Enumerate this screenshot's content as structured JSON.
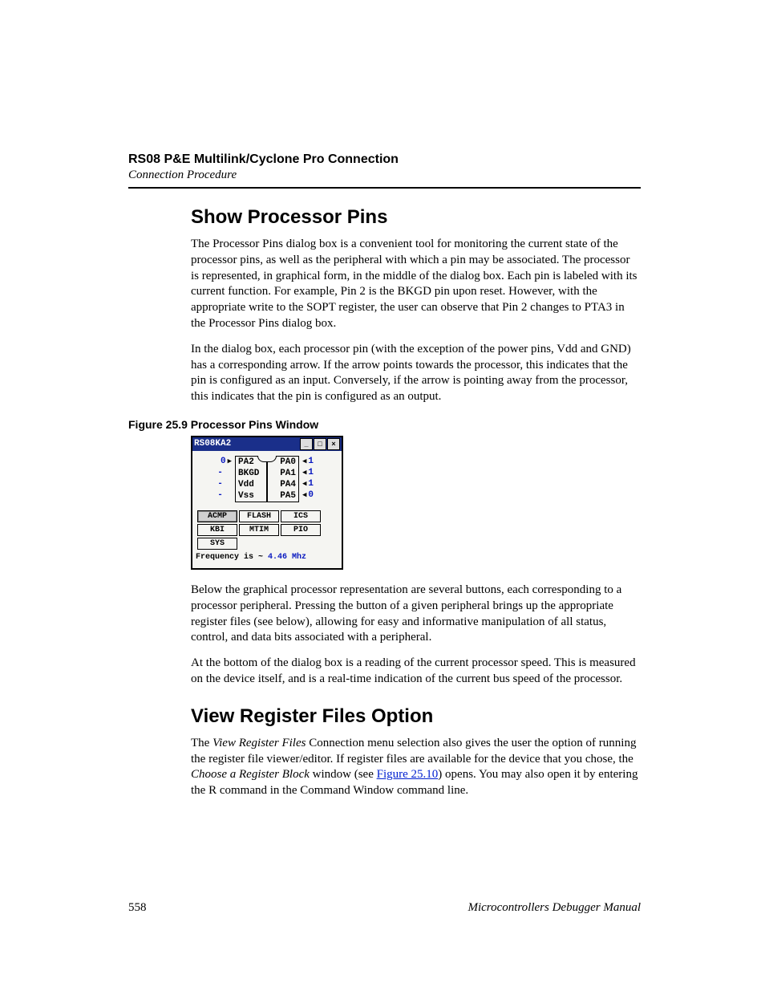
{
  "header": {
    "title": "RS08 P&E Multilink/Cyclone Pro Connection",
    "subtitle": "Connection Procedure"
  },
  "sections": {
    "s1": {
      "heading": "Show Processor Pins",
      "p1": "The Processor Pins dialog box is a convenient tool for monitoring the current state of the processor pins, as well as the peripheral with which a pin may be associated. The processor is represented, in graphical form, in the middle of the dialog box. Each pin is labeled with its current function. For example, Pin 2 is the BKGD pin upon reset. However, with the appropriate write to the SOPT register, the user can observe that Pin 2 changes to PTA3 in the Processor Pins dialog box.",
      "p2": "In the dialog box, each processor pin (with the exception of the power pins, Vdd and GND) has a corresponding arrow. If the arrow points towards the processor, this indicates that the pin is configured as an input. Conversely, if the arrow is pointing away from the processor, this indicates that the pin is configured as an output."
    },
    "figure": {
      "caption": "Figure 25.9  Processor Pins Window",
      "dlg_title": "RS08KA2",
      "pins": {
        "l1_val": "0",
        "l1_lbl": "PA2",
        "r1_lbl": "PA0",
        "r1_val": "1",
        "l2_val": "-",
        "l2_lbl": "BKGD",
        "r2_lbl": "PA1",
        "r2_val": "1",
        "l3_val": "-",
        "l3_lbl": "Vdd",
        "r3_lbl": "PA4",
        "r3_val": "1",
        "l4_val": "-",
        "l4_lbl": "Vss",
        "r4_lbl": "PA5",
        "r4_val": "0"
      },
      "buttons": {
        "b1": "ACMP",
        "b2": "FLASH",
        "b3": "ICS",
        "b4": "KBI",
        "b5": "MTIM",
        "b6": "PIO",
        "b7": "SYS"
      },
      "freq_label": "Frequency is ~ ",
      "freq_value": "4.46 Mhz"
    },
    "after_fig": {
      "p1": "Below the graphical processor representation are several buttons, each corresponding to a processor peripheral. Pressing the button of a given peripheral brings up the appropriate register files (see below), allowing for easy and informative manipulation of all status, control, and data bits associated with a peripheral.",
      "p2": "At the bottom of the dialog box is a reading of the current processor speed. This is measured on the device itself, and is a real-time indication of the current bus speed of the processor."
    },
    "s2": {
      "heading": "View Register Files Option",
      "p1a": "The ",
      "p1b": "View Register Files",
      "p1c": " Connection menu selection also gives the user the option of running the register file viewer/editor. If register files are available for the device that you chose, the ",
      "p1d": "Choose a Register Block",
      "p1e": " window (see ",
      "p1link": "Figure 25.10",
      "p1f": ") opens. You may also open it by entering the R command in the Command Window command line."
    }
  },
  "footer": {
    "page": "558",
    "manual": "Microcontrollers Debugger Manual"
  }
}
